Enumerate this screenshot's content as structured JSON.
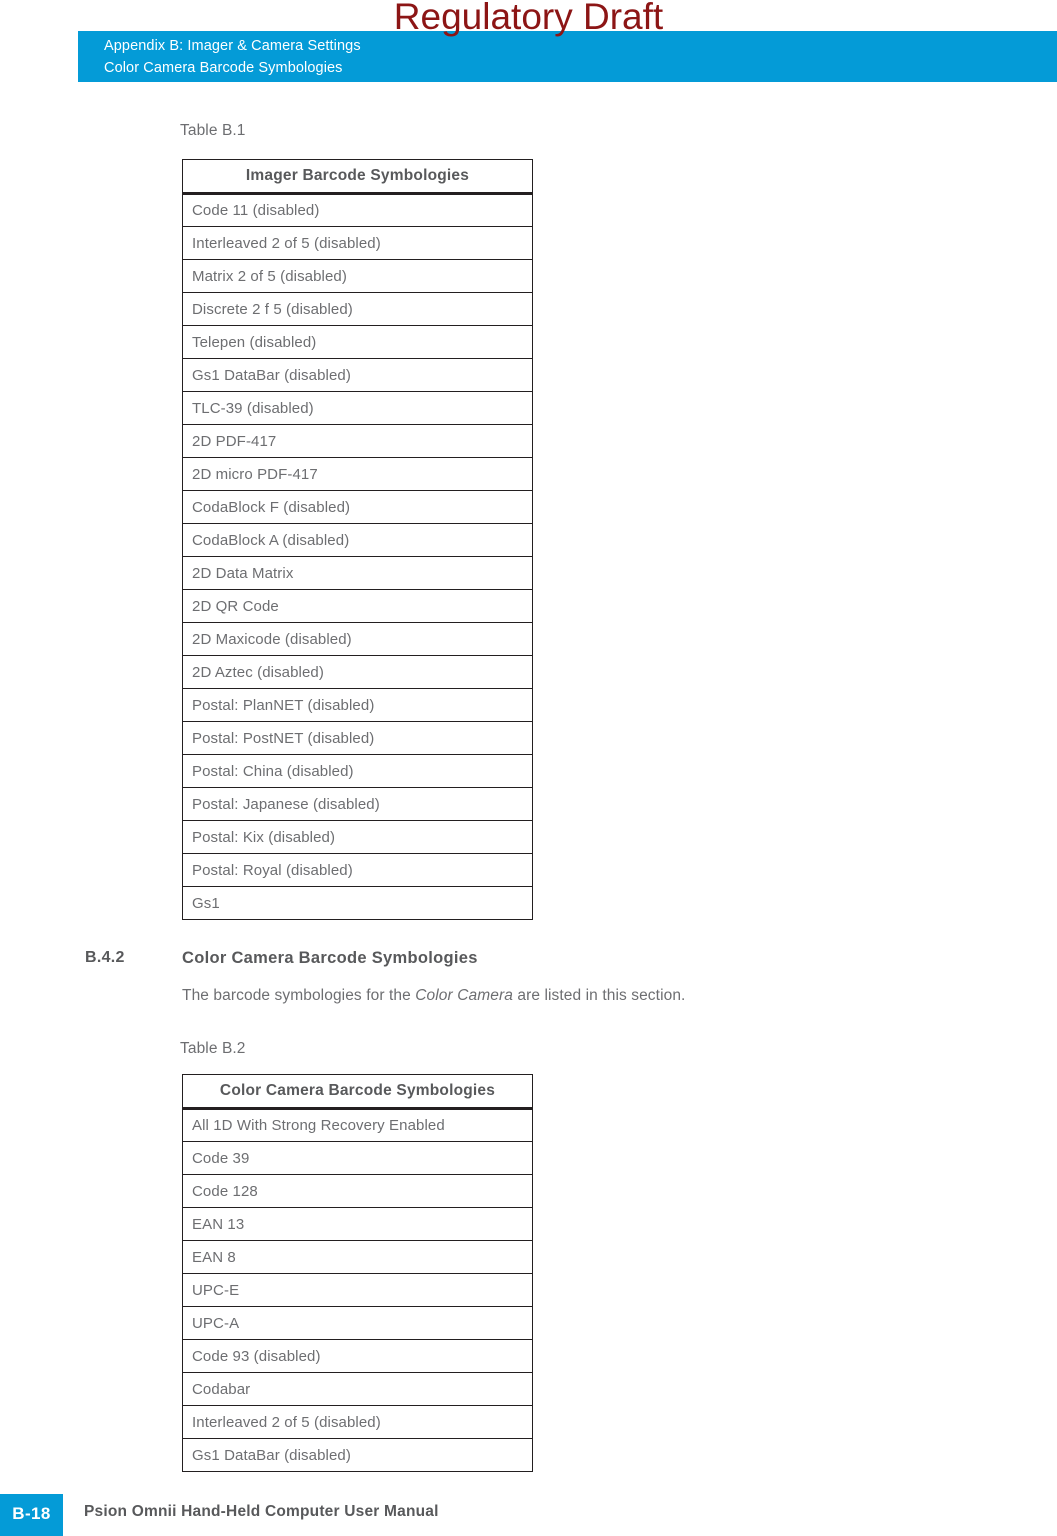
{
  "watermark": {
    "text": "Regulatory Draft",
    "color": "#8c1515"
  },
  "header": {
    "band_color": "#049bd7",
    "line1": "Appendix B: Imager & Camera Settings",
    "line2": "Color Camera Barcode Symbologies"
  },
  "table1": {
    "caption": "Table B.1",
    "header": "Imager Barcode Symbologies",
    "rows": [
      "Code 11 (disabled)",
      "Interleaved 2 of 5 (disabled)",
      "Matrix 2 of 5 (disabled)",
      "Discrete 2 f 5 (disabled)",
      "Telepen (disabled)",
      "Gs1 DataBar (disabled)",
      "TLC-39 (disabled)",
      "2D PDF-417",
      "2D micro PDF-417",
      "CodaBlock F (disabled)",
      "CodaBlock A (disabled)",
      "2D Data Matrix",
      "2D QR Code",
      "2D Maxicode (disabled)",
      "2D Aztec (disabled)",
      "Postal: PlanNET (disabled)",
      "Postal: PostNET (disabled)",
      "Postal: China (disabled)",
      "Postal: Japanese (disabled)",
      "Postal: Kix (disabled)",
      "Postal: Royal (disabled)",
      "Gs1"
    ]
  },
  "section": {
    "number": "B.4.2",
    "title": "Color Camera Barcode Symbologies",
    "body_before": "The barcode symbologies for the ",
    "body_italic": "Color Camera",
    "body_after": " are listed in this section."
  },
  "table2": {
    "caption": "Table B.2",
    "header": "Color Camera Barcode Symbologies",
    "rows": [
      "All 1D With Strong Recovery Enabled",
      "Code 39",
      "Code 128",
      "EAN 13",
      "EAN 8",
      "UPC-E",
      "UPC-A",
      "Code 93 (disabled)",
      "Codabar",
      "Interleaved 2 of 5 (disabled)",
      "Gs1 DataBar (disabled)"
    ]
  },
  "footer": {
    "page": "B-18",
    "title": "Psion Omnii Hand-Held Computer User Manual",
    "badge_color": "#049bd7"
  }
}
